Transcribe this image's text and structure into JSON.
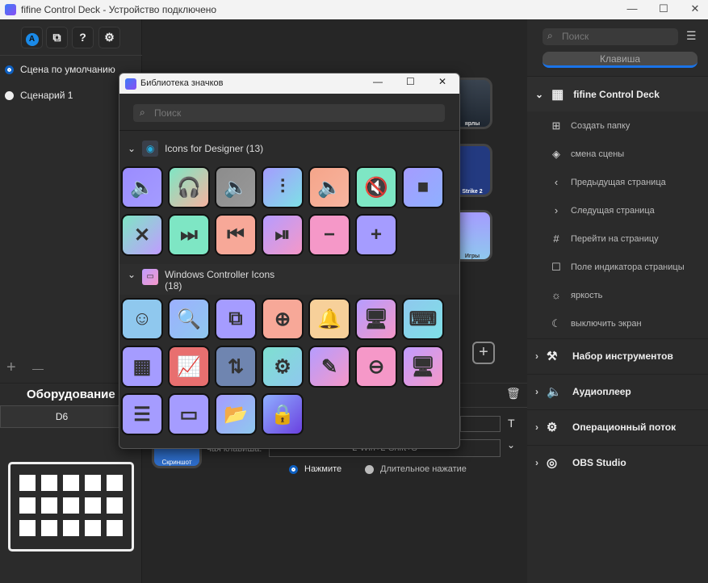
{
  "window": {
    "title": "fifine Control Deck - Устройство подключено",
    "minimize": "—",
    "maximize": "☐",
    "close": "✕"
  },
  "left": {
    "toolbar": [
      {
        "icon": "store-icon",
        "glyph": "A"
      },
      {
        "icon": "profiles-icon",
        "glyph": "⧉"
      },
      {
        "icon": "help-icon",
        "glyph": "?"
      },
      {
        "icon": "gear-icon",
        "glyph": "⚙"
      }
    ],
    "scenes": [
      {
        "label": "Сцена по умолчанию",
        "selected": true
      },
      {
        "label": "Сценарий 1",
        "selected": false
      }
    ],
    "add": "+",
    "remove": "—",
    "hardware_title": "Оборудование",
    "device": "D6"
  },
  "center": {
    "tiles": [
      {
        "caption": "ярлы"
      },
      {
        "caption": "Strike 2"
      },
      {
        "caption": "Игры"
      }
    ],
    "hotkey_label": "чая клавиша:",
    "hotkey_value": "L-Win+L-Shift+S",
    "screenshot_caption": "Скриншот",
    "press": "Нажмите",
    "long_press": "Длительное нажатие",
    "text_icon": "T"
  },
  "right": {
    "search_placeholder": "Поиск",
    "tab": "Клавиша",
    "accent": "#1a73e8",
    "root": "fifine Control Deck",
    "items": [
      {
        "label": "Создать папку",
        "glyph": "⊞"
      },
      {
        "label": "смена сцены",
        "glyph": "◈"
      },
      {
        "label": "Предыдущая страница",
        "glyph": "‹"
      },
      {
        "label": "Следущая страница",
        "glyph": "›"
      },
      {
        "label": "Перейти на страницу",
        "glyph": "#"
      },
      {
        "label": "Поле индикатора страницы",
        "glyph": "☐"
      },
      {
        "label": "яркость",
        "glyph": "☼"
      },
      {
        "label": "выключить экран",
        "glyph": "☾"
      }
    ],
    "groups": [
      {
        "label": "Набор инструментов",
        "glyph": "⚒"
      },
      {
        "label": "Аудиоплеер",
        "glyph": "🔈"
      },
      {
        "label": "Операционный поток",
        "glyph": "⚙"
      },
      {
        "label": "OBS Studio",
        "glyph": "◎"
      }
    ]
  },
  "dialog": {
    "title": "Библиотека значков",
    "search_placeholder": "Поиск",
    "sections": [
      {
        "title": "Icons for Designer (13)",
        "tiles": [
          {
            "icon": "volume-icon",
            "g": "🔈",
            "c": [
              "#9b8cff",
              "#a49cff"
            ]
          },
          {
            "icon": "headphones-icon",
            "g": "🎧",
            "c": [
              "#7ee6c4",
              "#f5b3a0"
            ]
          },
          {
            "icon": "volume-gray-icon",
            "g": "🔈",
            "c": [
              "#8c8c8c",
              "#999999"
            ]
          },
          {
            "icon": "equalizer-icon",
            "g": "⫶",
            "c": [
              "#a59cff",
              "#7ee0e6"
            ]
          },
          {
            "icon": "headphone-volume-icon",
            "g": "🔈",
            "c": [
              "#f5a58a",
              "#f7b5a0"
            ]
          },
          {
            "icon": "mute-icon",
            "g": "🔇",
            "c": [
              "#7ee6c4",
              "#7ee6c4"
            ]
          },
          {
            "icon": "stop-icon",
            "g": "■",
            "c": [
              "#a59cff",
              "#8fb0ff"
            ]
          },
          {
            "icon": "volume-off-icon",
            "g": "✕",
            "c": [
              "#7ee6c4",
              "#c09cff"
            ]
          },
          {
            "icon": "next-track-icon",
            "g": "⏭",
            "c": [
              "#7ee6c4",
              "#7ee6c4"
            ]
          },
          {
            "icon": "previous-track-icon",
            "g": "⏮",
            "c": [
              "#f7a898",
              "#f7a898"
            ]
          },
          {
            "icon": "play-pause-icon",
            "g": "⏯",
            "c": [
              "#b59cff",
              "#f598c8"
            ]
          },
          {
            "icon": "volume-down-icon",
            "g": "−",
            "c": [
              "#f598c8",
              "#f598c8"
            ]
          },
          {
            "icon": "volume-up-icon",
            "g": "+",
            "c": [
              "#a59cff",
              "#a59cff"
            ]
          }
        ]
      },
      {
        "title": "Windows Controller Icons",
        "count": "(18)",
        "tiles": [
          {
            "icon": "smiley-icon",
            "g": "☺",
            "c": [
              "#8fc8ee",
              "#8fc8ee"
            ]
          },
          {
            "icon": "document-search-icon",
            "g": "🔍",
            "c": [
              "#9cb0ff",
              "#8fc8ee"
            ]
          },
          {
            "icon": "windows-icon",
            "g": "⧉",
            "c": [
              "#a59cff",
              "#a59cff"
            ]
          },
          {
            "icon": "zoom-in-icon",
            "g": "⊕",
            "c": [
              "#f7a898",
              "#f7a898"
            ]
          },
          {
            "icon": "bell-icon",
            "g": "🔔",
            "c": [
              "#f7d09a",
              "#f7d09a"
            ]
          },
          {
            "icon": "desktop-back-icon",
            "g": "🖥",
            "c": [
              "#b59cff",
              "#f598c8"
            ]
          },
          {
            "icon": "keyboard-icon",
            "g": "⌨",
            "c": [
              "#8fc8ee",
              "#7ee0e6"
            ]
          },
          {
            "icon": "grid-icon",
            "g": "▦",
            "c": [
              "#a59cff",
              "#a59cff"
            ]
          },
          {
            "icon": "performance-monitor-icon",
            "g": "📈",
            "c": [
              "#e86f6f",
              "#e86f6f"
            ]
          },
          {
            "icon": "arrows-icon",
            "g": "⇅",
            "c": [
              "#6f85b0",
              "#6f85b0"
            ]
          },
          {
            "icon": "settings-icon",
            "g": "⚙",
            "c": [
              "#7ee0d0",
              "#8fc8ee"
            ]
          },
          {
            "icon": "pen-icon",
            "g": "✎",
            "c": [
              "#b59cff",
              "#f598c8"
            ]
          },
          {
            "icon": "zoom-out-icon",
            "g": "⊖",
            "c": [
              "#f598c8",
              "#f598c8"
            ]
          },
          {
            "icon": "desktop-settings-icon",
            "g": "🖥",
            "c": [
              "#c09cff",
              "#f598c8"
            ]
          },
          {
            "icon": "select-text-icon",
            "g": "☰",
            "c": [
              "#a59cff",
              "#a59cff"
            ]
          },
          {
            "icon": "fast-window-icon",
            "g": "▭",
            "c": [
              "#a59cff",
              "#a59cff"
            ]
          },
          {
            "icon": "folder-share-icon",
            "g": "📂",
            "c": [
              "#a59cff",
              "#8fc8ee"
            ]
          },
          {
            "icon": "lock-screen-icon",
            "g": "🔒",
            "c": [
              "#8fb0ff",
              "#6a40e0"
            ]
          }
        ]
      }
    ]
  }
}
